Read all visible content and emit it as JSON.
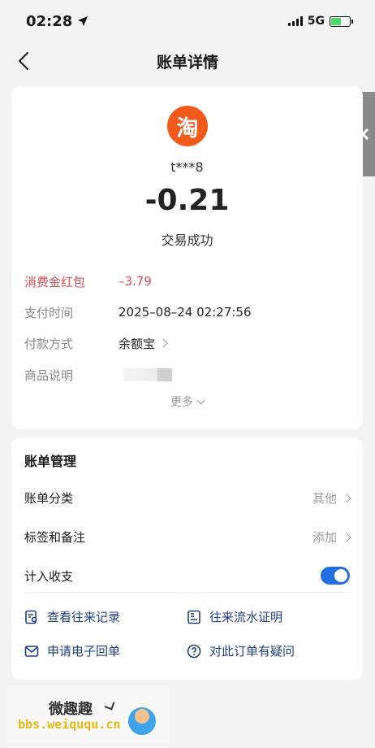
{
  "status_bar": {
    "time": "02:28",
    "network": "5G"
  },
  "nav": {
    "title": "账单详情"
  },
  "merchant": {
    "logo_char": "淘",
    "name": "t***8"
  },
  "transaction": {
    "amount": "-0.21",
    "status": "交易成功"
  },
  "details": [
    {
      "label": "消费金红包",
      "value": "–3.79"
    },
    {
      "label": "支付时间",
      "value": "2025–08–24 02:27:56"
    },
    {
      "label": "付款方式",
      "value": "余额宝"
    },
    {
      "label": "商品说明",
      "value": ""
    }
  ],
  "more_label": "更多",
  "manage": {
    "title": "账单管理",
    "category": {
      "label": "账单分类",
      "value": "其他"
    },
    "tags": {
      "label": "标签和备注",
      "value": "添加"
    },
    "include": {
      "label": "计入收支",
      "enabled": true
    }
  },
  "links": [
    {
      "label": "查看往来记录"
    },
    {
      "label": "往来流水证明"
    },
    {
      "label": "申请电子回单"
    },
    {
      "label": "对此订单有疑问"
    }
  ],
  "watermark": {
    "title": "微趣趣",
    "url": "bbs.weiququ.cn"
  }
}
